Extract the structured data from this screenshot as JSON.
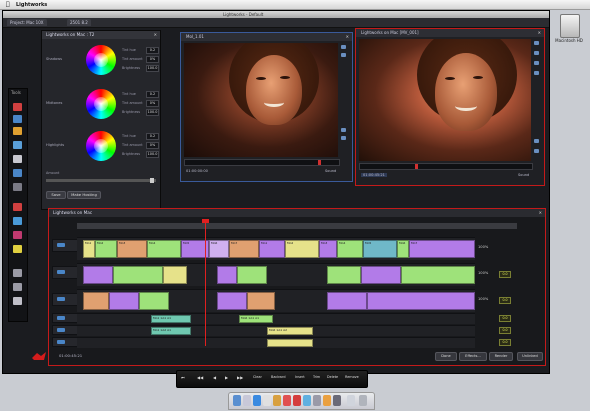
{
  "menubar": {
    "app_name": "Lightworks"
  },
  "desktop": {
    "drive_label": "Macintosh HD"
  },
  "window": {
    "title": "Lightworks - Default"
  },
  "tabs": [
    "Project: Mac 10X",
    "2501 8.2"
  ],
  "tools": {
    "label": "Tools"
  },
  "color_panel": {
    "title": "Lightworks on Mac : T2",
    "sections": [
      {
        "name": "Shadows",
        "params": [
          {
            "label": "Tint hue",
            "value": "0.2"
          },
          {
            "label": "Tint amount",
            "value": "0%"
          },
          {
            "label": "Brightness",
            "value": "100.0"
          }
        ]
      },
      {
        "name": "Midtones",
        "params": [
          {
            "label": "Tint hue",
            "value": "0.2"
          },
          {
            "label": "Tint amount",
            "value": "0%"
          },
          {
            "label": "Brightness",
            "value": "100.0"
          }
        ]
      },
      {
        "name": "Highlights",
        "params": [
          {
            "label": "Tint hue",
            "value": "0.2"
          },
          {
            "label": "Tint amount",
            "value": "0%"
          },
          {
            "label": "Brightness",
            "value": "100.0"
          }
        ]
      }
    ],
    "amount_label": "Amount",
    "buttons": [
      "Save",
      "Make Hosting"
    ]
  },
  "viewer_left": {
    "title": "Mol_1.01",
    "timecode": "01:00:00:00",
    "sound_label": "Sound"
  },
  "viewer_right": {
    "title": "Lightworks on Mac [MV_001]",
    "timecode": "01:00:45:21",
    "sound_label": "Sound"
  },
  "timeline": {
    "title": "Lightworks on Mac",
    "timecode": "01:00:45:21",
    "tracks": [
      "V1",
      "V2",
      "V3",
      "A1",
      "A2",
      "A3",
      "A4"
    ],
    "percentages": [
      "100%",
      "100%",
      "100%",
      "100%"
    ],
    "levels": [
      "0.0",
      "0.0",
      "0.0",
      "0.0",
      "0.0",
      "0.0"
    ],
    "buttons": [
      "Done",
      "Effects...",
      "Render",
      "Unlinked"
    ],
    "clips_row1": [
      "Mo1",
      "Mo2",
      "Mo3",
      "Mo4",
      "Mo5",
      "Mo6",
      "Mo7"
    ],
    "clips_audio": [
      "Mo1 1A1 A1",
      "Mo1 1A2 A1",
      "Mo6 1A1 A1",
      "Mo6 1A1 A2"
    ]
  },
  "transport": [
    "Clear",
    "Backwrd",
    "Insert",
    "Trim",
    "Delete",
    "Remove"
  ],
  "colors": {
    "accent_red": "#c41a1a",
    "clip_purple": "#b27be8",
    "clip_green": "#9ee27a",
    "clip_teal": "#6fb8c8",
    "clip_orange": "#e0a070",
    "clip_yellow": "#e6e28a"
  }
}
